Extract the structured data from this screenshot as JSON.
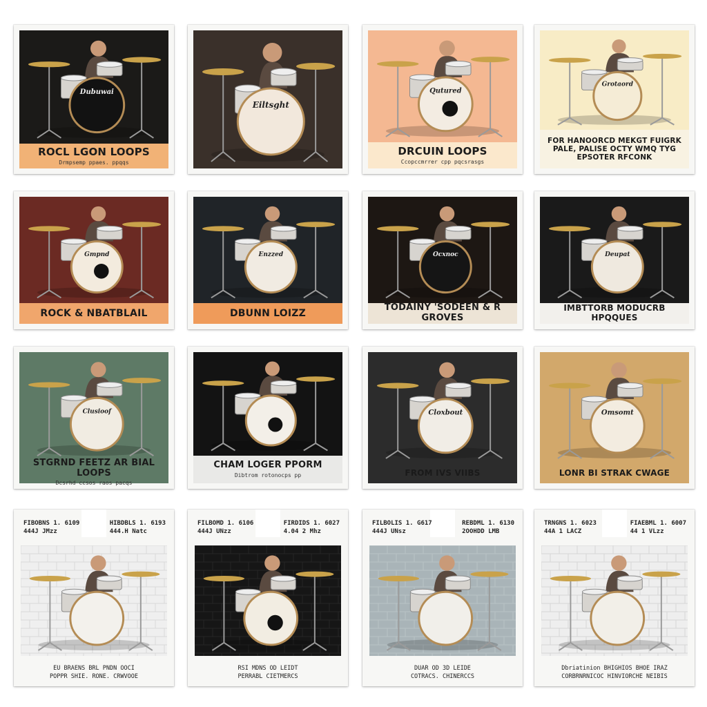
{
  "cards": [
    {
      "title": "ROCL LGON LOOPS",
      "subtitle": "Drmpsemp ppaes. ppqqs",
      "scene": {
        "bg": "#1b1a18",
        "kick_face": "#121212",
        "logo": "Dubuwai",
        "has_port": false
      },
      "band": "#f1b276"
    },
    {
      "title": "",
      "subtitle": "",
      "scene": {
        "bg": "#3a302a",
        "kick_face": "#f2e8dc",
        "logo": "Eiltsght",
        "has_port": false
      },
      "band": ""
    },
    {
      "title": "DRCUIN LOOPS",
      "subtitle": "Ccopccmrrer cpp pqcsrasgs",
      "scene": {
        "bg": "#f4b892",
        "kick_face": "#f3ece2",
        "logo": "Qutured",
        "has_port": true
      },
      "band": "#fbe8cc"
    },
    {
      "title": "FOR HANOORCD MEKGT FUIGRK PALE, PALISE OCTY WMQ TYG EPSOTER RFCONK",
      "subtitle": "",
      "scene": {
        "bg": "#f8ecc6",
        "kick_face": "#f5ecd6",
        "logo": "Grotaord",
        "has_port": false
      },
      "band": "#f8f2e2"
    },
    {
      "title": "ROCK & NBATBLAIL",
      "subtitle": "",
      "scene": {
        "bg": "#6b2a23",
        "kick_face": "#f3ebde",
        "logo": "Gmpnd",
        "has_port": true
      },
      "band": "#f0a66c"
    },
    {
      "title": "DBUNN LOIZZ",
      "subtitle": "",
      "scene": {
        "bg": "#202428",
        "kick_face": "#f1ebe2",
        "logo": "Enzzed",
        "has_port": false
      },
      "band": "#ef9b5a"
    },
    {
      "title": "TODAINY 'SODEEN & R GROVES",
      "subtitle": "",
      "scene": {
        "bg": "#1d1713",
        "kick_face": "#151515",
        "logo": "Ocxnoc",
        "has_port": false
      },
      "band": "#ede4d6"
    },
    {
      "title": "IMBTTORB MODUCRB HPQQUES",
      "subtitle": "",
      "scene": {
        "bg": "#1a1a1a",
        "kick_face": "#efe9df",
        "logo": "Deupat",
        "has_port": false
      },
      "band": "#f2f0ec"
    },
    {
      "title": "STGRND FEETZ AR BIAL LOOPS",
      "subtitle": "Dcsrhd ccsos raos pacqs",
      "scene": {
        "bg": "#5e7a66",
        "kick_face": "#f1ece2",
        "logo": "Clusioof",
        "has_port": false
      },
      "band": "#5e7a66"
    },
    {
      "title": "CHAM LOGER PPORM",
      "subtitle": "Dibtrom rotonocps pp",
      "scene": {
        "bg": "#131313",
        "kick_face": "#f3efe8",
        "logo": "",
        "has_port": true
      },
      "band": "#e9e9e7"
    },
    {
      "title": "FROM IVS VIIBS",
      "subtitle": "",
      "scene": {
        "bg": "#2c2c2c",
        "kick_face": "#f1ede6",
        "logo": "Cloxbout",
        "has_port": false
      },
      "band": "#2c2c2c"
    },
    {
      "title": "LONR BI STRAK CWAGE",
      "subtitle": "",
      "scene": {
        "bg": "#d2a86b",
        "kick_face": "#f3ece0",
        "logo": "Omsomt",
        "has_port": false
      },
      "band": "#d2a86b"
    }
  ],
  "row4": [
    {
      "spec_left": [
        "FIBOBNS 1. 6109",
        "444J JMzz"
      ],
      "spec_right": [
        "HIBDBLS 1. 6193",
        "444.H Natc"
      ],
      "footer": [
        "EU BRAENS BRL PNDN OOCI",
        "POPPR SHIE. RONE. CRWVOOE"
      ],
      "scene": {
        "bg": "#efefef",
        "brick": "#d8d8d8",
        "kick_face": "#f3f1ec",
        "has_port": false
      }
    },
    {
      "spec_left": [
        "FILBOMD 1. 6106",
        "444J UNzz"
      ],
      "spec_right": [
        "FIRDIDS 1. 6027",
        "4.04 2 Mhz"
      ],
      "footer": [
        "RSI MDNS OD LEIDT",
        "PERRABL CIETMERCS"
      ],
      "scene": {
        "bg": "#161616",
        "brick": "#262626",
        "kick_face": "#f2ede2",
        "has_port": true
      }
    },
    {
      "spec_left": [
        "FILBOLIS 1. G617",
        "444J UNsz"
      ],
      "spec_right": [
        "REBDML 1. 6130",
        "2OOHDD LMB"
      ],
      "footer": [
        "DUAR OD 3D LEIDE",
        "COTRACS. CHINERCCS"
      ],
      "scene": {
        "bg": "#a9b4b8",
        "brick": "#b9c3c6",
        "kick_face": "#f1efea",
        "has_port": false
      }
    },
    {
      "spec_left": [
        "TRNGNS 1. 6023",
        "44A 1 LACZ"
      ],
      "spec_right": [
        "FIAEBML 1. 6007",
        "44 1 VLzz"
      ],
      "footer": [
        "Dbriatinion BHIGHIOS BHOE IRAZ",
        "CORBRNRNICOC HINVIORCHE NEIBIS"
      ],
      "scene": {
        "bg": "#eeeeee",
        "brick": "#d6d6d6",
        "kick_face": "#f2efe8",
        "has_port": false
      }
    }
  ]
}
